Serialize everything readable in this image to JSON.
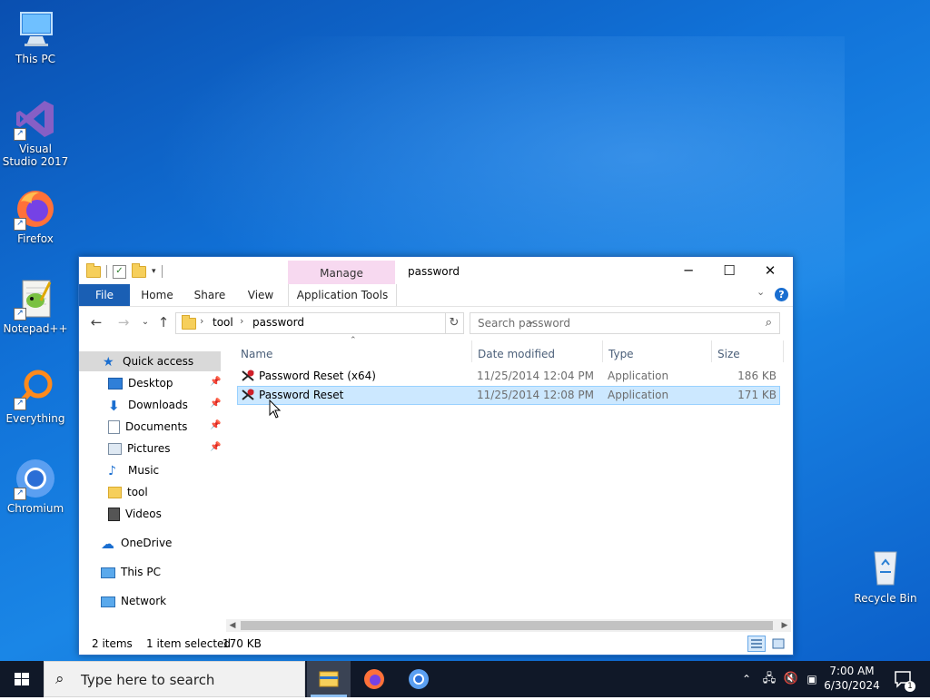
{
  "desktop": {
    "icons": [
      {
        "label": "This PC"
      },
      {
        "label": "Visual Studio 2017"
      },
      {
        "label": "Firefox"
      },
      {
        "label": "Notepad++"
      },
      {
        "label": "Everything"
      },
      {
        "label": "Chromium"
      },
      {
        "label": "Recycle Bin"
      }
    ]
  },
  "window": {
    "title": "password",
    "contextual_tab_group": "Manage",
    "ribbon_tabs": [
      "File",
      "Home",
      "Share",
      "View",
      "Application Tools"
    ],
    "controls": {
      "minimize": "─",
      "maximize": "☐",
      "close": "✕"
    },
    "help": "?"
  },
  "address": {
    "breadcrumbs": [
      "tool",
      "password"
    ],
    "search_placeholder": "Search password"
  },
  "nav_pane": {
    "items": [
      {
        "label": "Quick access",
        "icon": "star-icon"
      },
      {
        "label": "Desktop",
        "icon": "desktop-icon",
        "pinned": true
      },
      {
        "label": "Downloads",
        "icon": "download-icon",
        "pinned": true
      },
      {
        "label": "Documents",
        "icon": "document-icon",
        "pinned": true
      },
      {
        "label": "Pictures",
        "icon": "pictures-icon",
        "pinned": true
      },
      {
        "label": "Music",
        "icon": "music-icon"
      },
      {
        "label": "tool",
        "icon": "folder-icon"
      },
      {
        "label": "Videos",
        "icon": "video-icon"
      },
      {
        "label": "OneDrive",
        "icon": "cloud-icon"
      },
      {
        "label": "This PC",
        "icon": "computer-icon"
      },
      {
        "label": "Network",
        "icon": "network-icon"
      }
    ]
  },
  "file_list": {
    "columns": [
      "Name",
      "Date modified",
      "Type",
      "Size"
    ],
    "rows": [
      {
        "name": "Password Reset (x64)",
        "date": "11/25/2014 12:04 PM",
        "type": "Application",
        "size": "186 KB",
        "selected": false
      },
      {
        "name": "Password Reset",
        "date": "11/25/2014 12:08 PM",
        "type": "Application",
        "size": "171 KB",
        "selected": true
      }
    ]
  },
  "status": {
    "item_count": "2 items",
    "selection": "1 item selected",
    "size": "170 KB"
  },
  "taskbar": {
    "search_placeholder": "Type here to search",
    "time": "7:00 AM",
    "date": "6/30/2024",
    "notification_count": "1"
  },
  "colors": {
    "accent": "#1a5fb4",
    "selection": "#cce8ff",
    "manage_tab": "#f7d9f0"
  }
}
